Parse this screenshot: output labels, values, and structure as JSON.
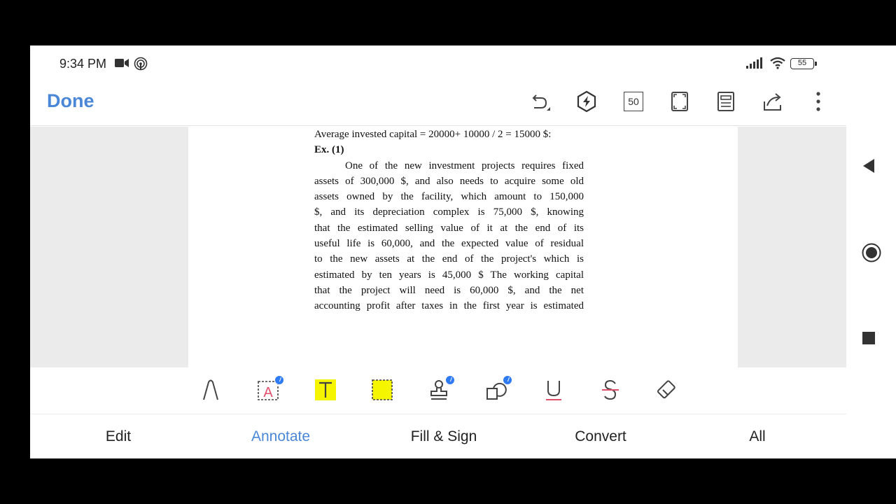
{
  "status_bar": {
    "time": "9:34 PM",
    "battery": "55"
  },
  "toolbar": {
    "done_label": "Done",
    "zoom_level": "50"
  },
  "document": {
    "lines": [
      "Average invested capital = 20000+ 10000 / 2 = 15000 $:",
      "Ex. (1)",
      "One of the new investment projects requires fixed",
      "assets of 300,000 $, and also needs to acquire some old",
      "assets owned by the facility, which amount to 150,000",
      "$, and its depreciation complex is 75,000 $, knowing",
      "that the estimated selling value of it at the end of its",
      "useful life is 60,000, and the  expected value of residual",
      "to the new assets at the end of the project's which is",
      "estimated by ten years is 45,000 $ The working capital",
      "that the project will need is 60,000 $, and the net",
      "accounting profit after taxes in the first year is estimated"
    ]
  },
  "annotate_tools": [
    {
      "name": "pen-tool-icon"
    },
    {
      "name": "text-box-tool-icon"
    },
    {
      "name": "highlight-text-tool-icon"
    },
    {
      "name": "area-highlight-tool-icon"
    },
    {
      "name": "stamp-tool-icon"
    },
    {
      "name": "shapes-tool-icon"
    },
    {
      "name": "underline-tool-icon"
    },
    {
      "name": "strikethrough-tool-icon"
    },
    {
      "name": "eraser-tool-icon"
    }
  ],
  "bottom_tabs": {
    "edit": "Edit",
    "annotate": "Annotate",
    "fill_sign": "Fill & Sign",
    "convert": "Convert",
    "all": "All"
  },
  "colors": {
    "accent": "#4a87d6",
    "highlight_yellow": "#f5f500",
    "badge_blue": "#2f7bf5",
    "page_gray": "#ebebeb"
  }
}
